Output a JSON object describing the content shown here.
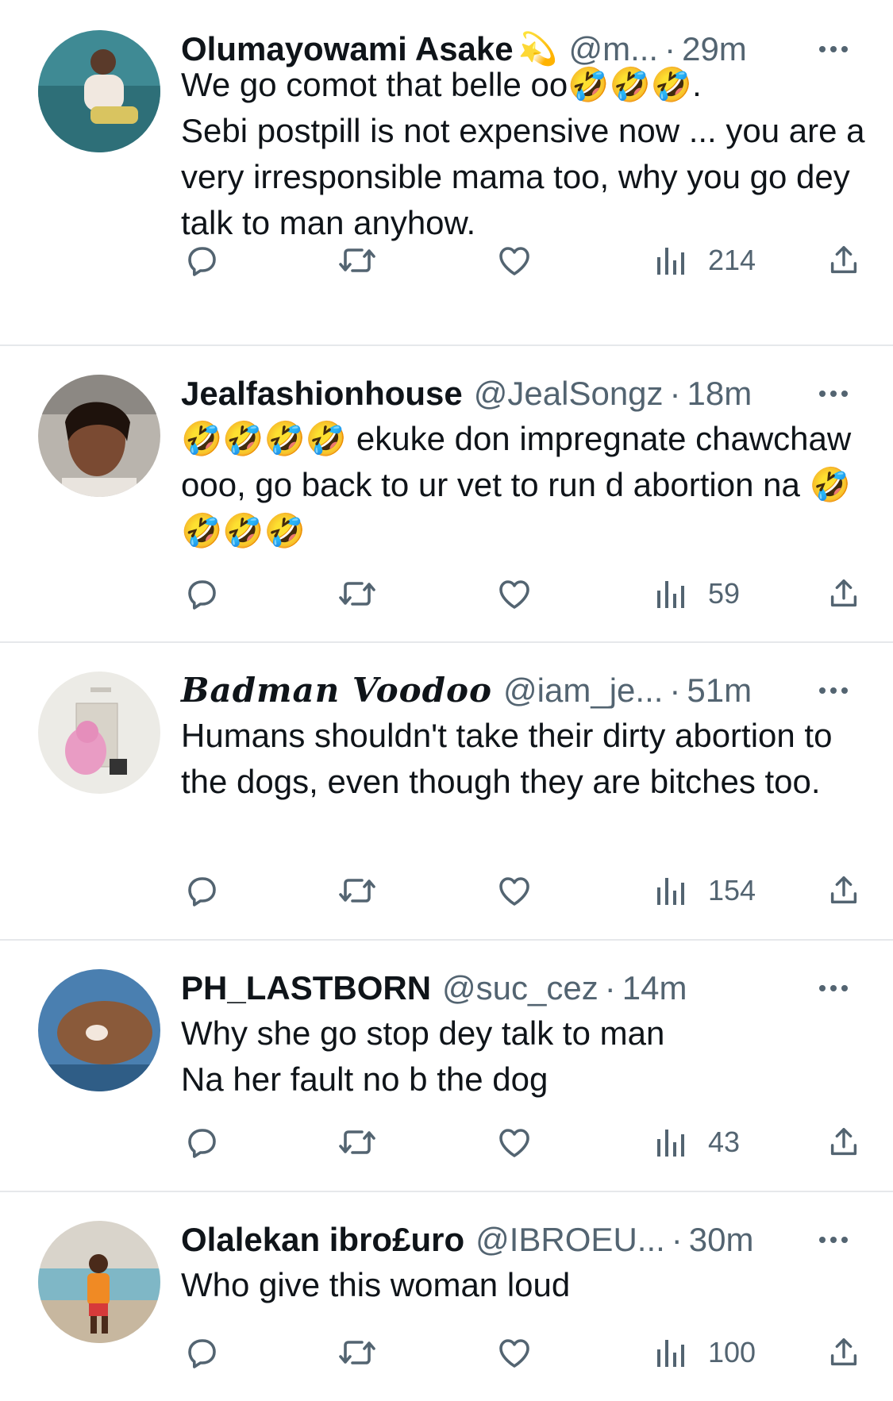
{
  "tweets": [
    {
      "name": "Olumayowami Asake",
      "badge": "💫",
      "handle": "@m...",
      "separator": "·",
      "time": "29m",
      "text": "We go comot that belle oo🤣🤣🤣.\nSebi postpill is not expensive now ... you are a very irresponsible mama too, why you go dey talk to man anyhow.",
      "views": "214"
    },
    {
      "name": "Jealfashionhouse",
      "badge": "",
      "handle": "@JealSongz",
      "separator": "·",
      "time": "18m",
      "text": "🤣🤣🤣🤣 ekuke don impregnate chawchaw ooo, go back to ur vet to run d abortion na 🤣🤣🤣🤣",
      "views": "59"
    },
    {
      "name": "Badman Voodoo",
      "badge": "",
      "handle": "@iam_je...",
      "separator": "·",
      "time": "51m",
      "text": "Humans shouldn't take their dirty abortion to the dogs, even though they are bitches too.",
      "views": "154"
    },
    {
      "name": "PH_LASTBORN",
      "badge": "",
      "handle": "@suc_cez",
      "separator": "·",
      "time": "14m",
      "text": "Why she go stop dey talk to man\nNa her fault no b the dog",
      "views": "43"
    },
    {
      "name": "Olalekan ibro£uro",
      "badge": "",
      "handle": "@IBROEU...",
      "separator": "·",
      "time": "30m",
      "text": "Who give this woman loud",
      "views": "100"
    }
  ],
  "icons": {
    "reply": "reply-icon",
    "retweet": "retweet-icon",
    "like": "like-icon",
    "views": "views-icon",
    "share": "share-icon",
    "more": "more-icon"
  },
  "colors": {
    "text": "#0f1419",
    "secondary": "#536471",
    "divider": "#e6e8eb"
  }
}
